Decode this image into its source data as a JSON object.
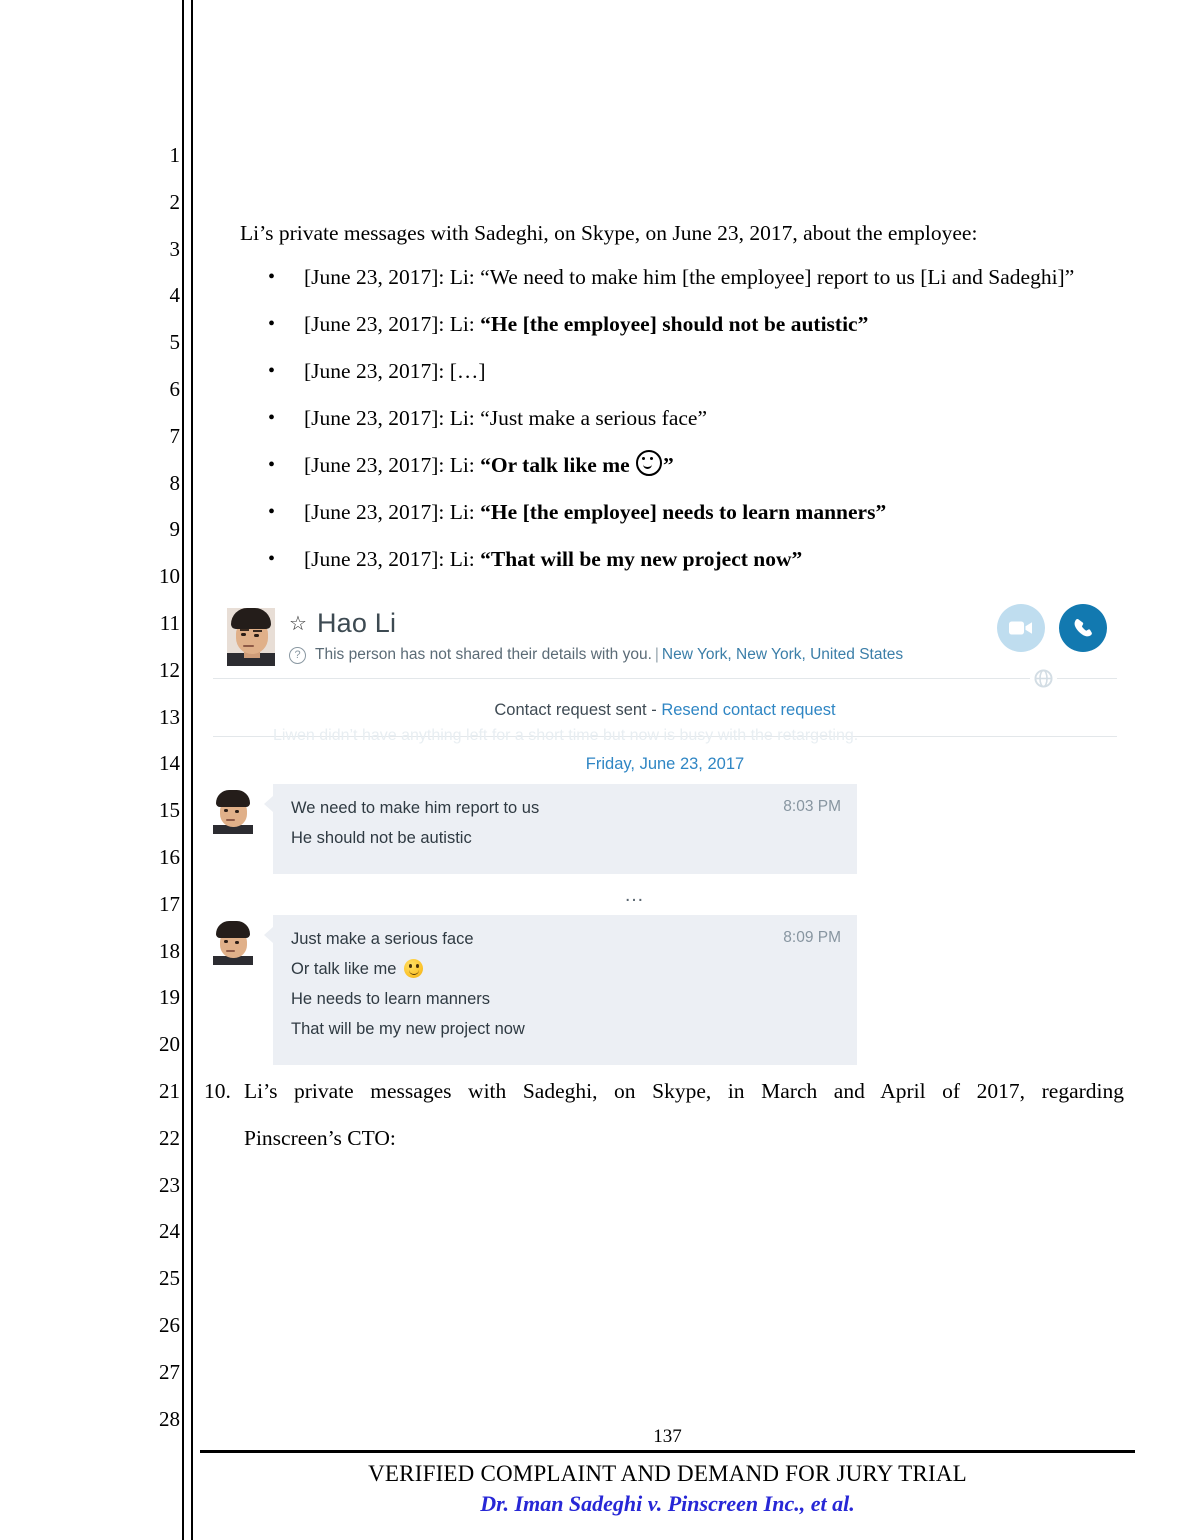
{
  "document": {
    "line_numbers": [
      "1",
      "2",
      "3",
      "4",
      "5",
      "6",
      "7",
      "8",
      "9",
      "10",
      "11",
      "12",
      "13",
      "14",
      "15",
      "16",
      "17",
      "18",
      "19",
      "20",
      "21",
      "22",
      "23",
      "24",
      "25",
      "26",
      "27",
      "28"
    ],
    "intro_paragraph": "Li’s private messages with Sadeghi, on Skype, on June 23, 2017, about the employee:",
    "bullets": [
      {
        "prefix": "[June 23, 2017]: Li: “We need to make him [the employee] report to us [Li and Sadeghi]”",
        "bold": "",
        "suffix": "",
        "emoji": false
      },
      {
        "prefix": "[June 23, 2017]: Li: ",
        "bold": "“He [the employee] should not be autistic”",
        "suffix": "",
        "emoji": false
      },
      {
        "prefix": "[June 23, 2017]: […]",
        "bold": "",
        "suffix": "",
        "emoji": false
      },
      {
        "prefix": "[June 23, 2017]: Li: “Just make a serious face”",
        "bold": "",
        "suffix": "",
        "emoji": false
      },
      {
        "prefix": "[June 23, 2017]: Li: ",
        "bold": "“Or talk like me ",
        "suffix": "”",
        "emoji": true
      },
      {
        "prefix": "[June 23, 2017]: Li: ",
        "bold": "“He [the employee] needs to learn manners”",
        "suffix": "",
        "emoji": false
      },
      {
        "prefix": "[June 23, 2017]: Li: ",
        "bold": "“That will be my new project now”",
        "suffix": "",
        "emoji": false
      }
    ],
    "paragraph_10": {
      "number": "10.",
      "line1": "Li’s private messages with Sadeghi, on Skype, in March and April of 2017, regarding",
      "line2": "Pinscreen’s CTO:"
    },
    "footer": {
      "page_number": "137",
      "title": "VERIFIED COMPLAINT AND DEMAND FOR JURY TRIAL",
      "case_caption": "Dr. Iman Sadeghi v. Pinscreen Inc., et al.",
      "caption_color": "#2727d6"
    }
  },
  "skype": {
    "header": {
      "contact_name": "Hao Li",
      "star_icon": "star-icon",
      "info_icon": "question-mark-icon",
      "details_text": "This person has not shared their details with you.",
      "separator": "|",
      "location": "New York, New York, United States",
      "video_button_icon": "video-camera-icon",
      "call_button_icon": "phone-icon",
      "video_button_color": "#bfddef",
      "call_button_color": "#1279b0",
      "globe_icon": "globe-icon"
    },
    "contact_request": {
      "status_text": "Contact request sent - ",
      "resend_link": "Resend contact request",
      "link_color": "#2f86c4"
    },
    "ghost_message": "Liwen didn’t have anything left for a short time but now is busy with the retargeting.",
    "date_divider": "Friday, June 23, 2017",
    "conversation": [
      {
        "sender_avatar": "contact-avatar",
        "lines": [
          {
            "text": "We need to make him report to us",
            "emoji": false
          },
          {
            "text": "He should not be autistic",
            "emoji": false
          }
        ],
        "time": "8:03 PM"
      },
      {
        "sender_avatar": "contact-avatar",
        "lines": [
          {
            "text": "Just make a serious face",
            "emoji": false
          },
          {
            "text": "Or talk like me ",
            "emoji": true
          },
          {
            "text": "He needs to learn manners",
            "emoji": false
          },
          {
            "text": "That will be my new project now",
            "emoji": false
          }
        ],
        "time": "8:09 PM"
      }
    ],
    "ellipsis_divider": "…",
    "bubble_color": "#eceff4"
  }
}
